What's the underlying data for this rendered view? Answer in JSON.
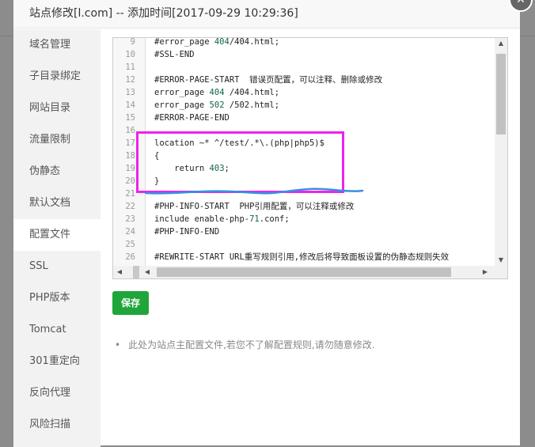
{
  "dialog": {
    "title": "站点修改[l.com] -- 添加时间[2017-09-29 10:29:36]",
    "close_icon": "close-icon"
  },
  "sidebar": {
    "active": "配置文件",
    "items": [
      {
        "label": "域名管理"
      },
      {
        "label": "子目录绑定"
      },
      {
        "label": "网站目录"
      },
      {
        "label": "流量限制"
      },
      {
        "label": "伪静态"
      },
      {
        "label": "默认文档"
      },
      {
        "label": "配置文件"
      },
      {
        "label": "SSL"
      },
      {
        "label": "PHP版本"
      },
      {
        "label": "Tomcat"
      },
      {
        "label": "301重定向"
      },
      {
        "label": "反向代理"
      },
      {
        "label": "风险扫描"
      }
    ]
  },
  "editor": {
    "colors": {
      "number": "#116644",
      "highlight_box": "#ee22ee",
      "underline": "#3a8ee0"
    },
    "lines": [
      {
        "n": "9",
        "tokens": [
          {
            "t": "#error_page "
          },
          {
            "t": "404",
            "num": true
          },
          {
            "t": "/404.html;"
          }
        ]
      },
      {
        "n": "10",
        "tokens": [
          {
            "t": "#SSL-END"
          }
        ]
      },
      {
        "n": "11",
        "tokens": []
      },
      {
        "n": "12",
        "tokens": [
          {
            "t": "#ERROR-PAGE-START  错误页配置，可以注释、删除或修改"
          }
        ]
      },
      {
        "n": "13",
        "tokens": [
          {
            "t": "error_page "
          },
          {
            "t": "404",
            "num": true
          },
          {
            "t": " /404.html;"
          }
        ]
      },
      {
        "n": "14",
        "tokens": [
          {
            "t": "error_page "
          },
          {
            "t": "502",
            "num": true
          },
          {
            "t": " /502.html;"
          }
        ]
      },
      {
        "n": "15",
        "tokens": [
          {
            "t": "#ERROR-PAGE-END"
          }
        ]
      },
      {
        "n": "16",
        "tokens": []
      },
      {
        "n": "17",
        "tokens": [
          {
            "t": "location ~* ^/test/.*\\.(php|php5)$"
          }
        ]
      },
      {
        "n": "18",
        "tokens": [
          {
            "t": "{"
          }
        ]
      },
      {
        "n": "19",
        "tokens": [
          {
            "t": "    return "
          },
          {
            "t": "403",
            "num": true
          },
          {
            "t": ";"
          }
        ]
      },
      {
        "n": "20",
        "tokens": [
          {
            "t": "}"
          }
        ]
      },
      {
        "n": "21",
        "tokens": []
      },
      {
        "n": "22",
        "tokens": [
          {
            "t": "#PHP-INFO-START  PHP引用配置，可以注释或修改"
          }
        ]
      },
      {
        "n": "23",
        "tokens": [
          {
            "t": "include enable-php-"
          },
          {
            "t": "71",
            "num": true
          },
          {
            "t": ".conf;"
          }
        ]
      },
      {
        "n": "24",
        "tokens": [
          {
            "t": "#PHP-INFO-END"
          }
        ]
      },
      {
        "n": "25",
        "tokens": []
      },
      {
        "n": "26",
        "tokens": [
          {
            "t": "#REWRITE-START URL重写规则引用,修改后将导致面板设置的伪静态规则失效"
          }
        ]
      }
    ]
  },
  "save_button": {
    "label": "保存",
    "color": "#20a53a"
  },
  "note": {
    "bullet": "•",
    "text": "此处为站点主配置文件,若您不了解配置规则,请勿随意修改."
  }
}
